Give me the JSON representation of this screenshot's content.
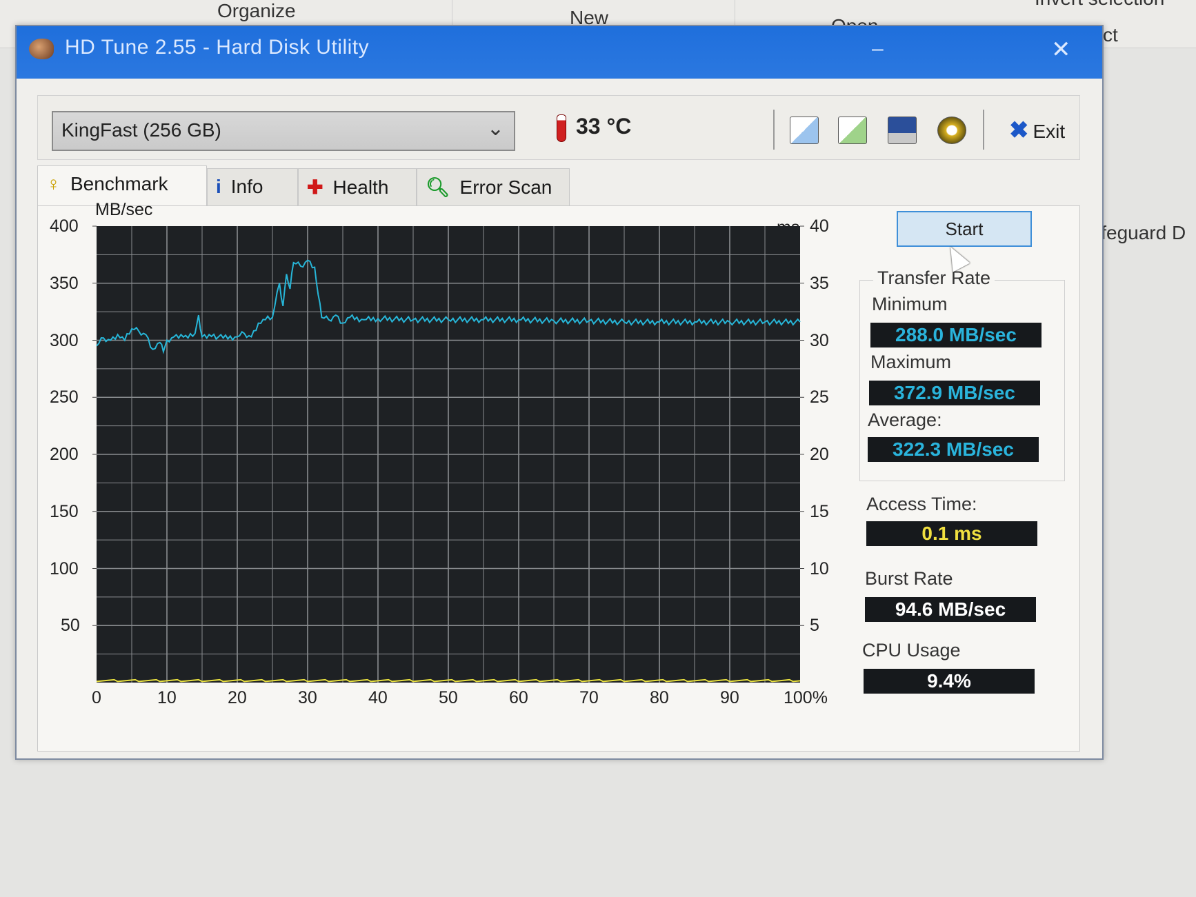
{
  "background": {
    "ribbon": [
      "Organize",
      "New",
      "Open",
      "Select",
      "Invert selection"
    ],
    "side_text": "ifeguard D"
  },
  "window": {
    "title": "HD Tune 2.55 - Hard Disk Utility",
    "minimize": "–",
    "close": "✕"
  },
  "toolbar": {
    "drive": "KingFast (256 GB)",
    "temperature": "33 °C",
    "icons": [
      "copy-info-icon",
      "copy-screenshot-icon",
      "save-icon",
      "options-icon"
    ],
    "exit_label": "Exit"
  },
  "tabs": [
    {
      "label": "Benchmark",
      "icon": "benchmark-icon",
      "active": true
    },
    {
      "label": "Info",
      "icon": "info-icon"
    },
    {
      "label": "Health",
      "icon": "health-cross-icon"
    },
    {
      "label": "Error Scan",
      "icon": "magnifier-icon"
    }
  ],
  "side": {
    "start_label": "Start",
    "transfer_rate": "Transfer Rate",
    "minimum_label": "Minimum",
    "minimum": "288.0 MB/sec",
    "maximum_label": "Maximum",
    "maximum": "372.9 MB/sec",
    "average_label": "Average:",
    "average": "322.3 MB/sec",
    "access_label": "Access Time:",
    "access": "0.1 ms",
    "burst_label": "Burst Rate",
    "burst": "94.6 MB/sec",
    "cpu_label": "CPU Usage",
    "cpu": "9.4%"
  },
  "colors": {
    "transfer": "#27b6d8",
    "access": "#e8e040",
    "plot_bg": "#1e2124",
    "grid": "#8a8d90"
  },
  "chart_data": {
    "type": "line",
    "ylabel": "MB/sec",
    "y2label": "ms",
    "ylim": [
      0,
      400
    ],
    "y2lim": [
      0,
      40
    ],
    "xlim": [
      0,
      100
    ],
    "yticks": [
      "50",
      "100",
      "150",
      "200",
      "250",
      "300",
      "350",
      "400"
    ],
    "y2ticks": [
      "5",
      "10",
      "15",
      "20",
      "25",
      "30",
      "35",
      "40"
    ],
    "xticks": [
      "0",
      "10",
      "20",
      "30",
      "40",
      "50",
      "60",
      "70",
      "80",
      "90",
      "100%"
    ],
    "grid": true,
    "series": [
      {
        "axis": "left",
        "x": [
          0,
          1,
          2,
          3,
          4,
          5,
          6,
          7,
          8,
          9,
          9.5,
          10,
          11,
          12,
          13,
          14,
          14.5,
          15,
          16,
          18,
          20,
          21,
          22,
          23,
          24,
          25,
          26,
          26.5,
          27,
          27.5,
          28,
          29,
          30,
          31,
          31.5,
          32,
          33,
          34,
          35,
          36,
          38,
          40,
          45,
          50,
          55,
          60,
          65,
          70,
          75,
          80,
          85,
          90,
          95,
          100
        ],
        "values": [
          295,
          302,
          300,
          305,
          300,
          310,
          308,
          305,
          292,
          298,
          290,
          300,
          303,
          305,
          302,
          306,
          322,
          303,
          305,
          302,
          303,
          306,
          303,
          315,
          318,
          320,
          350,
          330,
          358,
          345,
          368,
          365,
          370,
          364,
          340,
          320,
          318,
          322,
          315,
          320,
          318,
          319,
          318,
          318,
          318,
          318,
          317,
          317,
          316,
          316,
          316,
          316,
          316,
          316
        ]
      },
      {
        "axis": "right",
        "x": [
          0,
          100
        ],
        "values": [
          0.1,
          0.1
        ]
      }
    ]
  }
}
